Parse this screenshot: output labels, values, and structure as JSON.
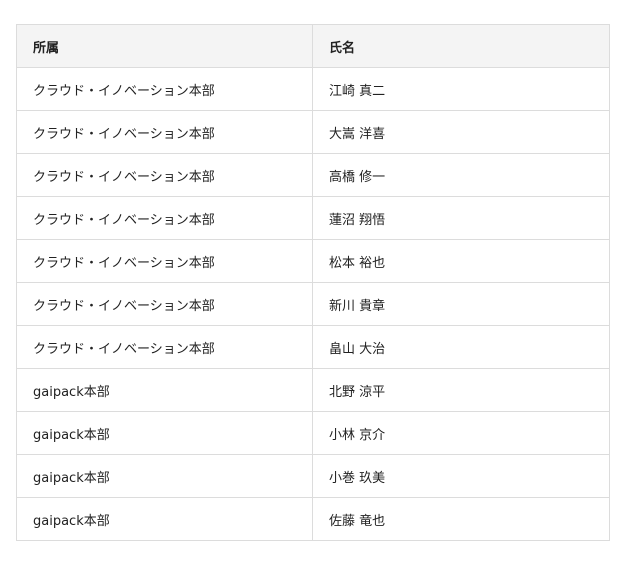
{
  "table": {
    "headers": [
      "所属",
      "氏名"
    ],
    "rows": [
      [
        "クラウド・イノベーション本部",
        "江崎 真二"
      ],
      [
        "クラウド・イノベーション本部",
        "大嵩 洋喜"
      ],
      [
        "クラウド・イノベーション本部",
        "高橋 修一"
      ],
      [
        "クラウド・イノベーション本部",
        "蓮沼 翔悟"
      ],
      [
        "クラウド・イノベーション本部",
        "松本 裕也"
      ],
      [
        "クラウド・イノベーション本部",
        "新川 貴章"
      ],
      [
        "クラウド・イノベーション本部",
        "畠山 大治"
      ],
      [
        "gaipack本部",
        "北野 涼平"
      ],
      [
        "gaipack本部",
        "小林 京介"
      ],
      [
        "gaipack本部",
        "小巻 玖美"
      ],
      [
        "gaipack本部",
        "佐藤 竜也"
      ]
    ]
  }
}
